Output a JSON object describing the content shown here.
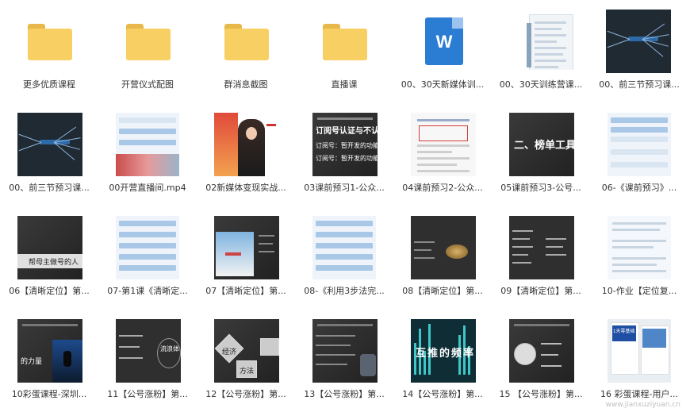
{
  "items": [
    {
      "label": "更多优质课程",
      "icon": "folder-icon"
    },
    {
      "label": "开营仪式配图",
      "icon": "folder-icon"
    },
    {
      "label": "群消息截图",
      "icon": "folder-icon"
    },
    {
      "label": "直播课",
      "icon": "folder-icon"
    },
    {
      "label": "00、30天新媒体训...",
      "icon": "word-document-icon"
    },
    {
      "label": "00、30天训练营课...",
      "icon": "document-icon"
    },
    {
      "label": "00、前三节预习课...",
      "icon": "mind-map-thumbnail"
    },
    {
      "label": "00、前三节预习课...",
      "icon": "mind-map-thumbnail"
    },
    {
      "label": "00开营直播间.mp4",
      "icon": "video-thumbnail"
    },
    {
      "label": "02新媒体变现实战...",
      "icon": "video-thumbnail"
    },
    {
      "label": "03课前预习1-公众...",
      "icon": "image-thumbnail"
    },
    {
      "label": "04课前预习2-公众...",
      "icon": "image-thumbnail"
    },
    {
      "label": "05课前预习3-公号...",
      "icon": "image-thumbnail"
    },
    {
      "label": "06-《课前预习》...",
      "icon": "image-thumbnail"
    },
    {
      "label": "06【清晰定位】第...",
      "icon": "image-thumbnail"
    },
    {
      "label": "07-第1课《清晰定...",
      "icon": "image-thumbnail"
    },
    {
      "label": "07【清晰定位】第...",
      "icon": "image-thumbnail"
    },
    {
      "label": "08-《利用3步法完...",
      "icon": "image-thumbnail"
    },
    {
      "label": "08【清晰定位】第...",
      "icon": "image-thumbnail"
    },
    {
      "label": "09【清晰定位】第...",
      "icon": "image-thumbnail"
    },
    {
      "label": "10-作业【定位复...",
      "icon": "image-thumbnail"
    },
    {
      "label": "10彩蛋课程-深圳...",
      "icon": "image-thumbnail"
    },
    {
      "label": "11【公号涨粉】第...",
      "icon": "image-thumbnail"
    },
    {
      "label": "12【公号涨粉】第...",
      "icon": "image-thumbnail"
    },
    {
      "label": "13【公号涨粉】第...",
      "icon": "image-thumbnail"
    },
    {
      "label": "14【公号涨粉】第...",
      "icon": "image-thumbnail"
    },
    {
      "label": "15 【公号涨粉】第...",
      "icon": "image-thumbnail"
    },
    {
      "label": "16 彩蛋课程-用户...",
      "icon": "image-thumbnail"
    }
  ],
  "thumb_text": {
    "t1": "订阅号认证与不认证的",
    "t2": "订阅号：暂开发的功能少，可升",
    "t3": "订阅号：暂开发的功能多，不能升",
    "t4": "二、榜单工具",
    "t5": "帮母主做号的人",
    "t6": "的力量",
    "t7": "互推的频率",
    "t8": "流浪体",
    "t9": "经济",
    "t10": "方法",
    "t11": "1天零基础 入门引流课"
  },
  "watermark": "www.jianxuziyuan.cn"
}
